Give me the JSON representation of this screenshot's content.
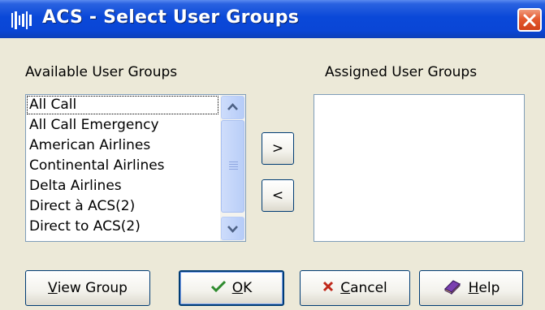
{
  "window": {
    "title": "ACS - Select User Groups",
    "icon": "app-icon",
    "close_icon": "close-icon"
  },
  "available": {
    "label": "Available User Groups",
    "items": [
      "All Call",
      "All Call Emergency",
      "American Airlines",
      "Continental Airlines",
      "Delta Airlines",
      "Direct à ACS(2)",
      "Direct to ACS(2)"
    ],
    "focused_index": 0
  },
  "assigned": {
    "label": "Assigned User Groups",
    "items": []
  },
  "transfer": {
    "add_label": ">",
    "remove_label": "<"
  },
  "buttons": {
    "view_group": {
      "label_underlined": "V",
      "label_rest": "iew Group"
    },
    "ok": {
      "label_underlined": "O",
      "label_rest": "K",
      "icon": "checkmark-icon"
    },
    "cancel": {
      "label_underlined": "C",
      "label_rest": "ancel",
      "icon": "x-icon"
    },
    "help": {
      "label_underlined": "H",
      "label_rest": "elp",
      "icon": "help-book-icon"
    }
  },
  "colors": {
    "title_bar": "#0a46d6",
    "close_button": "#e45a30",
    "ok_check": "#2e8b2e",
    "cancel_x": "#c0281a"
  }
}
